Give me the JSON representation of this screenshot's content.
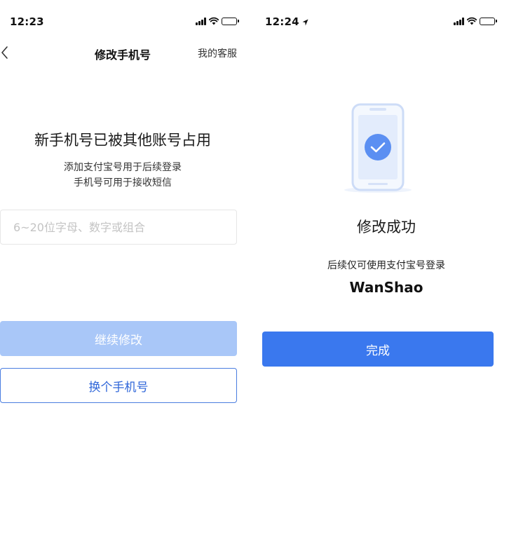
{
  "left_screen": {
    "status_time": "12:23",
    "nav": {
      "title": "修改手机号",
      "action": "我的客服"
    },
    "heading": "新手机号已被其他账号占用",
    "subtext_line1": "添加支付宝号用于后续登录",
    "subtext_line2": "手机号可用于接收短信",
    "input": {
      "placeholder": "6~20位字母、数字或组合",
      "value": ""
    },
    "continue_button": "继续修改",
    "change_phone_button": "换个手机号"
  },
  "right_screen": {
    "status_time": "12:24",
    "success_title": "修改成功",
    "success_desc": "后续仅可使用支付宝号登录",
    "account_name": "WanShao",
    "done_button": "完成"
  },
  "colors": {
    "primary": "#3a78ee",
    "primary_disabled": "#a9c7f8",
    "outline_text": "#2f66d9",
    "illustration_bg": "#e7effd",
    "check_circle": "#5b8ff2"
  },
  "icons": {
    "back": "chevron-left-icon",
    "signal": "cellular-signal-icon",
    "wifi": "wifi-icon",
    "battery": "battery-icon",
    "location": "location-arrow-icon",
    "success": "phone-check-icon"
  }
}
